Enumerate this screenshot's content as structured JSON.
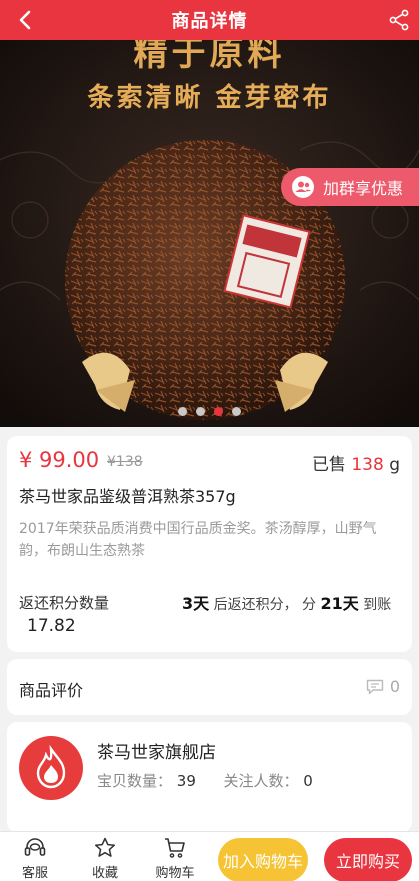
{
  "header": {
    "title": "商品详情",
    "back_icon": "chevron-left-icon",
    "share_icon": "share-icon",
    "bg_color": "#e8353f"
  },
  "hero": {
    "slogan_top": "精于原料",
    "slogan": "条索清晰 金芽密布",
    "group_pill_label": "加群享优惠",
    "group_pill_icon": "user-group-icon",
    "carousel": {
      "count": 4,
      "active_index": 3
    }
  },
  "product": {
    "price": "¥ 99.00",
    "original_price": "¥138",
    "sold_label": "已售",
    "sold_count": "138",
    "sold_unit": "g",
    "name": "茶马世家品鉴级普洱熟茶357g",
    "description": "2017年荣获品质消费中国行品质金奖。茶汤醇厚，山野气韵，布朗山生态熟茶",
    "points_label": "返还积分数量",
    "points_value": "17.82",
    "points_rule": {
      "days1": "3天",
      "text1": "后返还积分，",
      "text2": "分",
      "days2": "21天",
      "text3": "到账"
    },
    "accent_color": "#e8353f"
  },
  "review": {
    "title": "商品评价",
    "count": "0",
    "icon": "comment-icon"
  },
  "shop": {
    "name": "茶马世家旗舰店",
    "items_label": "宝贝数量：",
    "items_count": "39",
    "followers_label": "关注人数：",
    "followers_count": "0",
    "logo_icon": "flame-logo-icon"
  },
  "footer": {
    "service_label": "客服",
    "favorite_label": "收藏",
    "cart_label": "购物车",
    "add_to_cart": "加入购物车",
    "buy_now": "立即购买",
    "cart_button_color": "#f6c335"
  }
}
